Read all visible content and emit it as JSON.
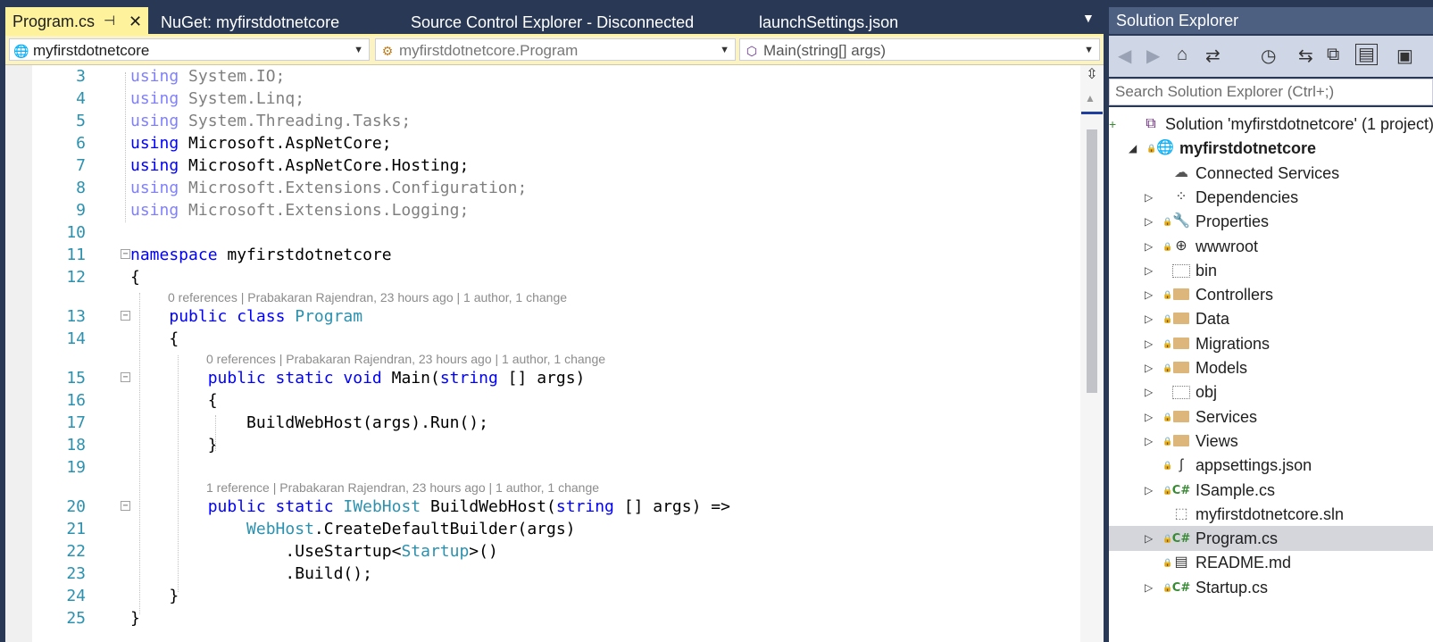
{
  "tabs": [
    {
      "label": "Program.cs",
      "active": true
    },
    {
      "label": "NuGet: myfirstdotnetcore"
    },
    {
      "label": "Source Control Explorer - Disconnected"
    },
    {
      "label": "launchSettings.json"
    }
  ],
  "tab_pin": "⊣",
  "tab_close": "✕",
  "navbar": {
    "project": "myfirstdotnetcore",
    "type": "myfirstdotnetcore.Program",
    "member": "Main(string[] args)"
  },
  "code": {
    "lines": [
      {
        "n": "3",
        "parts": [
          [
            "kw",
            "using"
          ],
          [
            "",
            "System.IO;"
          ]
        ],
        "dim": true
      },
      {
        "n": "4",
        "parts": [
          [
            "kw",
            "using"
          ],
          [
            "",
            "System.Linq;"
          ]
        ],
        "dim": true
      },
      {
        "n": "5",
        "parts": [
          [
            "kw",
            "using"
          ],
          [
            "",
            "System.Threading.Tasks;"
          ]
        ],
        "dim": true
      },
      {
        "n": "6",
        "parts": [
          [
            "kw",
            "using"
          ],
          [
            "",
            "Microsoft.AspNetCore;"
          ]
        ]
      },
      {
        "n": "7",
        "parts": [
          [
            "kw",
            "using"
          ],
          [
            "",
            "Microsoft.AspNetCore.Hosting;"
          ]
        ]
      },
      {
        "n": "8",
        "parts": [
          [
            "kw",
            "using"
          ],
          [
            "",
            "Microsoft.Extensions.Configuration;"
          ]
        ],
        "dim": true
      },
      {
        "n": "9",
        "parts": [
          [
            "kw",
            "using"
          ],
          [
            "",
            "Microsoft.Extensions.Logging;"
          ]
        ],
        "dim": true
      },
      {
        "n": "10",
        "parts": []
      },
      {
        "n": "11",
        "parts": [
          [
            "kw",
            "namespace"
          ],
          [
            "",
            "myfirstdotnetcore"
          ]
        ],
        "fold": true
      },
      {
        "n": "12",
        "parts": [
          [
            "",
            "{"
          ]
        ]
      },
      {
        "n": "13",
        "parts": [
          [
            "",
            "    "
          ],
          [
            "kw",
            "public class"
          ],
          [
            "ty",
            " Program"
          ]
        ],
        "fold": true
      },
      {
        "n": "14",
        "parts": [
          [
            "",
            "    {"
          ]
        ]
      },
      {
        "n": "15",
        "parts": [
          [
            "",
            "        "
          ],
          [
            "kw",
            "public static void"
          ],
          [
            "",
            " Main("
          ],
          [
            "kw",
            "string"
          ],
          [
            "",
            "[] args)"
          ]
        ],
        "fold": true
      },
      {
        "n": "16",
        "parts": [
          [
            "",
            "        {"
          ]
        ]
      },
      {
        "n": "17",
        "parts": [
          [
            "",
            "            BuildWebHost(args).Run();"
          ]
        ]
      },
      {
        "n": "18",
        "parts": [
          [
            "",
            "        }"
          ]
        ]
      },
      {
        "n": "19",
        "parts": []
      },
      {
        "n": "20",
        "parts": [
          [
            "",
            "        "
          ],
          [
            "kw",
            "public static"
          ],
          [
            "ty",
            " IWebHost"
          ],
          [
            "",
            " BuildWebHost("
          ],
          [
            "kw",
            "string"
          ],
          [
            "",
            "[] args) =>"
          ]
        ],
        "fold": true
      },
      {
        "n": "21",
        "parts": [
          [
            "",
            "            "
          ],
          [
            "ty",
            "WebHost"
          ],
          [
            "",
            ".CreateDefaultBuilder(args)"
          ]
        ]
      },
      {
        "n": "22",
        "parts": [
          [
            "",
            "                .UseStartup<"
          ],
          [
            "ty",
            "Startup"
          ],
          [
            "",
            ">()"
          ]
        ]
      },
      {
        "n": "23",
        "parts": [
          [
            "",
            "                .Build();"
          ]
        ]
      },
      {
        "n": "24",
        "parts": [
          [
            "",
            "    }"
          ]
        ]
      },
      {
        "n": "25",
        "parts": [
          [
            "",
            "}"
          ]
        ]
      }
    ],
    "codelens": [
      "0 references | Prabakaran Rajendran, 23 hours ago | 1 author, 1 change",
      "0 references | Prabakaran Rajendran, 23 hours ago | 1 author, 1 change",
      "1 reference | Prabakaran Rajendran, 23 hours ago | 1 author, 1 change"
    ]
  },
  "solution_explorer": {
    "title": "Solution Explorer",
    "search_placeholder": "Search Solution Explorer (Ctrl+;)",
    "items": [
      {
        "label": "Solution 'myfirstdotnetcore' (1 project)",
        "icon": "solution-icon",
        "depth": 0
      },
      {
        "label": "myfirstdotnetcore",
        "icon": "web-project-icon",
        "depth": 1,
        "bold": true,
        "expanded": true
      },
      {
        "label": "Connected Services",
        "icon": "cloud-icon",
        "depth": 2
      },
      {
        "label": "Dependencies",
        "icon": "dependencies-icon",
        "depth": 2,
        "collapsed": true
      },
      {
        "label": "Properties",
        "icon": "wrench-icon",
        "depth": 2,
        "collapsed": true,
        "locked": true
      },
      {
        "label": "wwwroot",
        "icon": "globe-icon",
        "depth": 2,
        "collapsed": true,
        "locked": true
      },
      {
        "label": "bin",
        "icon": "folder-dotted-icon",
        "depth": 2,
        "collapsed": true
      },
      {
        "label": "Controllers",
        "icon": "folder-icon",
        "depth": 2,
        "collapsed": true,
        "locked": true
      },
      {
        "label": "Data",
        "icon": "folder-icon",
        "depth": 2,
        "collapsed": true,
        "locked": true
      },
      {
        "label": "Migrations",
        "icon": "folder-icon",
        "depth": 2,
        "collapsed": true,
        "locked": true
      },
      {
        "label": "Models",
        "icon": "folder-icon",
        "depth": 2,
        "collapsed": true,
        "locked": true
      },
      {
        "label": "obj",
        "icon": "folder-dotted-icon",
        "depth": 2,
        "collapsed": true
      },
      {
        "label": "Services",
        "icon": "folder-icon",
        "depth": 2,
        "collapsed": true,
        "locked": true
      },
      {
        "label": "Views",
        "icon": "folder-icon",
        "depth": 2,
        "collapsed": true,
        "locked": true
      },
      {
        "label": "appsettings.json",
        "icon": "json-file-icon",
        "depth": 2,
        "locked": true
      },
      {
        "label": "ISample.cs",
        "icon": "csharp-file-icon",
        "depth": 2,
        "collapsed": true,
        "locked": true
      },
      {
        "label": "myfirstdotnetcore.sln",
        "icon": "file-dotted-icon",
        "depth": 2
      },
      {
        "label": "Program.cs",
        "icon": "csharp-file-icon",
        "depth": 2,
        "collapsed": true,
        "locked": true,
        "selected": true
      },
      {
        "label": "README.md",
        "icon": "text-file-icon",
        "depth": 2,
        "locked": true
      },
      {
        "label": "Startup.cs",
        "icon": "csharp-file-icon",
        "depth": 2,
        "collapsed": true,
        "locked": true
      }
    ]
  },
  "colors": {
    "chrome": "#293955",
    "active_tab": "#fff29d",
    "keyword": "#0000ff",
    "type": "#2b91af",
    "line_number": "#2b91af",
    "selection": "#d4d6db"
  }
}
